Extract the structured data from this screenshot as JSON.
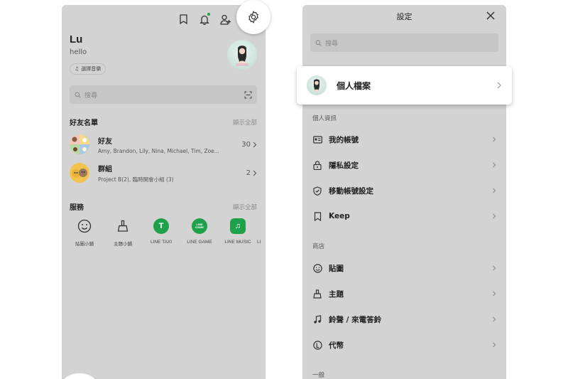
{
  "left": {
    "profile": {
      "name": "Lu",
      "status": "hello",
      "music_label": "選擇音樂"
    },
    "search_placeholder": "搜尋",
    "friends_section": {
      "title": "好友名單",
      "more": "顯示全部"
    },
    "friends": [
      {
        "title": "好友",
        "subtitle": "Amy, Brandon, Lily, Nina, Michael, Tim, Zoe...",
        "count": "30"
      },
      {
        "title": "群組",
        "subtitle": "Project B(2), 臨時開會小組 (3)",
        "count": "2"
      }
    ],
    "services_section": {
      "title": "服務",
      "more": "顯示全部"
    },
    "services": [
      {
        "label": "貼圖小舖",
        "icon": "smile-icon"
      },
      {
        "label": "主題小舖",
        "icon": "brush-icon"
      },
      {
        "label": "LINE TAXI",
        "icon": "line-taxi-icon",
        "glyph": "T"
      },
      {
        "label": "LINE GAME",
        "icon": "line-game-icon",
        "glyph": "LINE GAME"
      },
      {
        "label": "LINE MUSIC",
        "icon": "line-music-icon",
        "glyph": "♫"
      },
      {
        "label": "LI",
        "icon": "partial-service-icon"
      }
    ],
    "accent_green": "#1ea14a"
  },
  "right": {
    "title": "設定",
    "search_placeholder": "搜尋",
    "profile_card_label": "個人檔案",
    "sections": [
      {
        "title": "個人資訊",
        "items": [
          "我的帳號",
          "隱私設定",
          "移動帳號設定",
          "Keep"
        ]
      },
      {
        "title": "商店",
        "items": [
          "貼圖",
          "主題",
          "鈴聲 / 來電答鈴",
          "代幣"
        ]
      },
      {
        "title": "一般",
        "items": []
      }
    ]
  }
}
